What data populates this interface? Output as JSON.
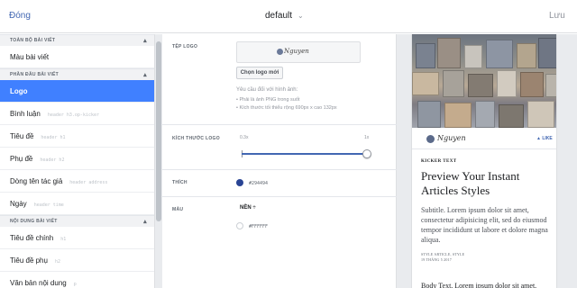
{
  "header": {
    "close_label": "Đóng",
    "style_name": "default",
    "save_label": "Lưu"
  },
  "sidebar": {
    "sections": [
      {
        "title": "TOÀN BỘ BÀI VIẾT",
        "items": [
          {
            "label": "Màu bài viết",
            "hint": ""
          }
        ]
      },
      {
        "title": "PHẦN ĐẦU BÀI VIẾT",
        "items": [
          {
            "label": "Logo",
            "hint": ""
          },
          {
            "label": "Bình luận",
            "hint": "header h3.op-kicker"
          },
          {
            "label": "Tiêu đề",
            "hint": "header h1"
          },
          {
            "label": "Phụ đề",
            "hint": "header h2"
          },
          {
            "label": "Dòng tên tác giả",
            "hint": "header address"
          },
          {
            "label": "Ngày",
            "hint": "header time"
          }
        ]
      },
      {
        "title": "NỘI DUNG BÀI VIẾT",
        "items": [
          {
            "label": "Tiêu đề chính",
            "hint": "h1"
          },
          {
            "label": "Tiêu đề phụ",
            "hint": "h2"
          },
          {
            "label": "Văn bản nội dung",
            "hint": "p"
          }
        ]
      }
    ],
    "active_item": "Logo"
  },
  "editor": {
    "logo_file_label": "TỆP LOGO",
    "logo_image_text": "Nguyen",
    "new_logo_button": "Chọn logo mới",
    "requirements_title": "Yêu cầu đối với hình ảnh:",
    "requirements": [
      "Phải là ảnh PNG trong suốt",
      "Kích thước tối thiểu rộng 690px x cao 132px"
    ],
    "logo_size_label": "KÍCH THƯỚC LOGO",
    "slider_min": "0.3x",
    "slider_max": "1x",
    "slider_value_fraction": 1.0,
    "tint_label": "THÍCH",
    "tint_color": "#294494",
    "tint_value": "#294494",
    "color_label": "MÀU",
    "background_select": "NỀN ÷",
    "background_color": "#FFFFFF",
    "background_value": "#FFFFFF"
  },
  "preview": {
    "logo_text": "Nguyen",
    "like_label": "LIKE",
    "kicker": "KICKER TEXT",
    "title": "Preview Your Instant Articles Styles",
    "subtitle": "Subtitle. Lorem ipsum dolor sit amet, consectetur adipisicing elit, sed do eiusmod tempor incididunt ut labore et dolore magna aliqua.",
    "byline": "STYLE ARTICLE, STYLE",
    "date": "19 THÁNG 5 2017",
    "body": "Body Text. Lorem ipsum dolor sit amet,"
  },
  "colors": {
    "accent": "#4267b2",
    "active_item_bg": "#4080ff"
  }
}
